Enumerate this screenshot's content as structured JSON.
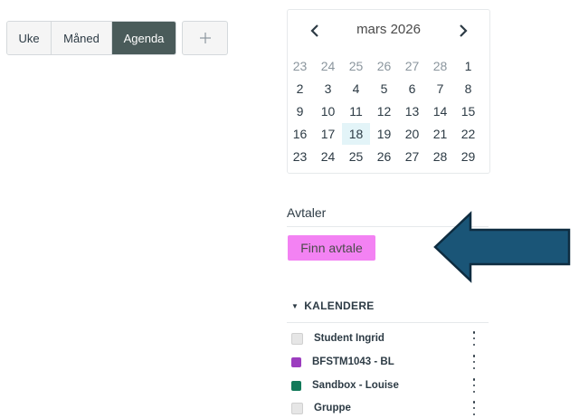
{
  "views": [
    {
      "label": "Uke",
      "active": false
    },
    {
      "label": "Måned",
      "active": false
    },
    {
      "label": "Agenda",
      "active": true
    }
  ],
  "add_icon": "plus-icon",
  "minical": {
    "title": "mars 2026",
    "prev_icon": "chevron-left-icon",
    "next_icon": "chevron-right-icon",
    "weeks": [
      [
        "23",
        "24",
        "25",
        "26",
        "27",
        "28",
        "1"
      ],
      [
        "2",
        "3",
        "4",
        "5",
        "6",
        "7",
        "8"
      ],
      [
        "9",
        "10",
        "11",
        "12",
        "13",
        "14",
        "15"
      ],
      [
        "16",
        "17",
        "18",
        "19",
        "20",
        "21",
        "22"
      ],
      [
        "23",
        "24",
        "25",
        "26",
        "27",
        "28",
        "29"
      ]
    ],
    "today": "18"
  },
  "avtaler": {
    "title": "Avtaler",
    "find_label": "Finn avtale",
    "highlight_color": "#f382f3",
    "arrow_color": "#1a5577"
  },
  "calendars": {
    "header": "KALENDERE",
    "items": [
      {
        "name": "Student Ingrid",
        "color": "#e6e6e6"
      },
      {
        "name": "BFSTM1043 - BL",
        "color": "#9c3dbf"
      },
      {
        "name": "Sandbox - Louise",
        "color": "#127a5a"
      },
      {
        "name": "Gruppe",
        "color": "#e6e6e6"
      }
    ]
  }
}
